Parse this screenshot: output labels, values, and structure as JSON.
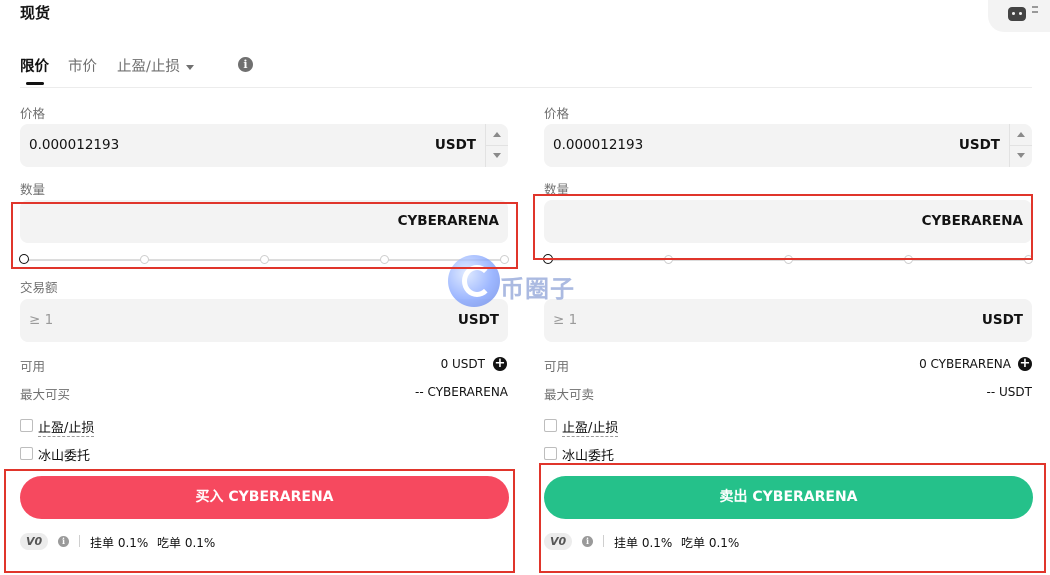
{
  "header": {
    "title": "现货"
  },
  "tabs": [
    {
      "label": "限价",
      "active": true
    },
    {
      "label": "市价",
      "active": false
    },
    {
      "label": "止盈/止损",
      "active": false
    }
  ],
  "buy": {
    "price_label": "价格",
    "price_value": "0.000012193",
    "price_unit": "USDT",
    "amount_label": "数量",
    "amount_unit": "CYBERARENA",
    "total_label": "交易额",
    "total_placeholder": "≥ 1",
    "total_unit": "USDT",
    "available_label": "可用",
    "available_value": "0 USDT",
    "max_label": "最大可买",
    "max_value": "-- CYBERARENA",
    "tpsl_label": "止盈/止损",
    "iceberg_label": "冰山委托",
    "button_label": "买入 CYBERARENA",
    "vip": "V0",
    "maker_fee": "挂单 0.1%",
    "taker_fee": "吃单 0.1%"
  },
  "sell": {
    "price_label": "价格",
    "price_value": "0.000012193",
    "price_unit": "USDT",
    "amount_label": "数量",
    "amount_unit": "CYBERARENA",
    "total_placeholder": "≥ 1",
    "total_unit": "USDT",
    "available_label": "可用",
    "available_value": "0 CYBERARENA",
    "max_label": "最大可卖",
    "max_value": "-- USDT",
    "tpsl_label": "止盈/止损",
    "iceberg_label": "冰山委托",
    "button_label": "卖出 CYBERARENA",
    "vip": "V0",
    "maker_fee": "挂单 0.1%",
    "taker_fee": "吃单 0.1%"
  },
  "watermark": {
    "text": "币圈子"
  },
  "colors": {
    "buy": "#f6495f",
    "sell": "#25c18a",
    "highlight": "#e0352b"
  },
  "icons": {
    "robot": "robot-icon",
    "info": "info-icon",
    "plus": "plus-circle-icon"
  }
}
